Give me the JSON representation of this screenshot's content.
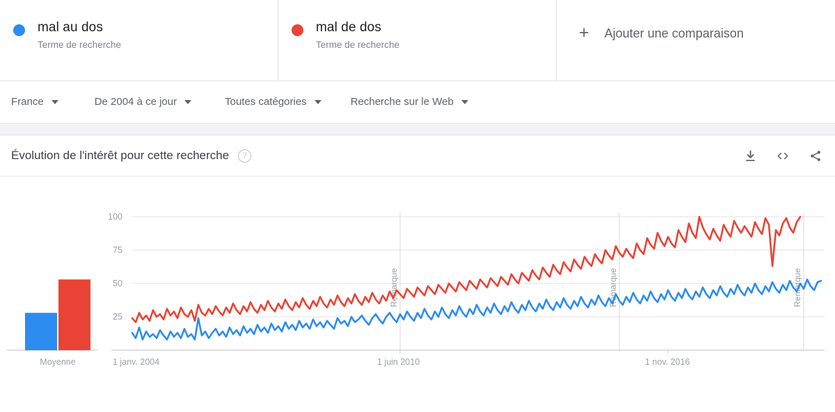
{
  "terms": [
    {
      "label": "mal au dos",
      "sublabel": "Terme de recherche",
      "color": "#2D8CF0",
      "dot": "blue-dot"
    },
    {
      "label": "mal de dos",
      "sublabel": "Terme de recherche",
      "color": "#EA4335",
      "dot": "red-dot"
    }
  ],
  "add_comparison": {
    "label": "Ajouter une comparaison",
    "icon": "plus-icon"
  },
  "filters": [
    {
      "label": "France",
      "name": "filter-region"
    },
    {
      "label": "De 2004 à ce jour",
      "name": "filter-timerange"
    },
    {
      "label": "Toutes catégories",
      "name": "filter-category"
    },
    {
      "label": "Recherche sur le Web",
      "name": "filter-searchtype"
    }
  ],
  "chart_header": {
    "title": "Évolution de l'intérêt pour cette recherche",
    "help": "?",
    "actions": [
      {
        "name": "download-icon",
        "title": "download"
      },
      {
        "name": "embed-code-icon",
        "title": "embed"
      },
      {
        "name": "share-icon",
        "title": "share"
      }
    ]
  },
  "average_panel": {
    "label": "Moyenne",
    "bars": [
      {
        "series": "mal au dos",
        "value": 28,
        "color": "#2D8CF0"
      },
      {
        "series": "mal de dos",
        "value": 53,
        "color": "#EA4335"
      }
    ]
  },
  "chart_data": {
    "type": "line",
    "title": "Évolution de l'intérêt pour cette recherche",
    "xlabel": "",
    "ylabel": "",
    "ylim": [
      0,
      100
    ],
    "yticks": [
      25,
      50,
      75,
      100
    ],
    "grid": true,
    "legend_position": "top",
    "x_tick_labels": [
      "1 janv. 2004",
      "1 juin 2010",
      "1 nov. 2016"
    ],
    "x_tick_index": [
      0,
      77,
      154
    ],
    "x_range": [
      "2004-01",
      "2020-08"
    ],
    "n_points": 200,
    "annotations": [
      {
        "label": "Remarque",
        "x_index": 77
      },
      {
        "label": "Remarque",
        "x_index": 140
      },
      {
        "label": "Remarque",
        "x_index": 193
      }
    ],
    "series": [
      {
        "name": "mal au dos",
        "color": "#2D8CF0",
        "values": [
          13,
          9,
          17,
          8,
          14,
          10,
          12,
          9,
          15,
          11,
          8,
          14,
          10,
          13,
          9,
          16,
          10,
          12,
          8,
          24,
          11,
          14,
          9,
          13,
          16,
          11,
          14,
          10,
          17,
          12,
          15,
          11,
          18,
          13,
          16,
          12,
          19,
          14,
          17,
          13,
          20,
          15,
          18,
          14,
          21,
          16,
          19,
          15,
          22,
          17,
          20,
          16,
          23,
          18,
          21,
          17,
          22,
          19,
          16,
          24,
          20,
          22,
          18,
          25,
          21,
          23,
          26,
          22,
          19,
          24,
          27,
          23,
          20,
          25,
          28,
          24,
          21,
          27,
          23,
          29,
          25,
          22,
          28,
          24,
          31,
          26,
          23,
          29,
          25,
          32,
          27,
          24,
          30,
          26,
          33,
          28,
          25,
          31,
          27,
          34,
          29,
          26,
          32,
          28,
          35,
          30,
          27,
          33,
          29,
          36,
          31,
          28,
          34,
          30,
          37,
          32,
          29,
          35,
          31,
          38,
          33,
          30,
          36,
          32,
          39,
          34,
          31,
          37,
          33,
          40,
          35,
          32,
          38,
          34,
          41,
          36,
          33,
          39,
          35,
          42,
          37,
          34,
          40,
          36,
          43,
          38,
          35,
          41,
          37,
          44,
          39,
          36,
          42,
          38,
          45,
          40,
          37,
          43,
          39,
          46,
          41,
          38,
          44,
          40,
          47,
          42,
          39,
          45,
          41,
          48,
          43,
          40,
          46,
          42,
          49,
          44,
          41,
          47,
          43,
          50,
          45,
          42,
          48,
          44,
          51,
          46,
          43,
          49,
          45,
          52,
          47,
          44,
          50,
          46,
          53,
          48,
          45,
          51,
          52
        ]
      },
      {
        "name": "mal de dos",
        "color": "#EA4335",
        "values": [
          24,
          21,
          28,
          23,
          26,
          22,
          30,
          25,
          27,
          23,
          31,
          26,
          29,
          24,
          32,
          27,
          25,
          30,
          22,
          34,
          28,
          26,
          31,
          27,
          33,
          29,
          26,
          32,
          28,
          35,
          30,
          27,
          33,
          29,
          36,
          31,
          28,
          34,
          30,
          37,
          32,
          29,
          35,
          31,
          38,
          33,
          30,
          36,
          32,
          39,
          34,
          31,
          37,
          33,
          40,
          35,
          32,
          38,
          34,
          41,
          36,
          33,
          39,
          35,
          42,
          37,
          34,
          40,
          36,
          43,
          38,
          35,
          41,
          37,
          44,
          39,
          45,
          42,
          39,
          46,
          43,
          40,
          47,
          44,
          41,
          48,
          45,
          42,
          49,
          46,
          43,
          50,
          47,
          44,
          51,
          48,
          45,
          52,
          49,
          46,
          53,
          50,
          47,
          54,
          51,
          48,
          55,
          52,
          49,
          57,
          53,
          50,
          58,
          55,
          52,
          60,
          56,
          53,
          62,
          58,
          55,
          64,
          60,
          57,
          66,
          62,
          59,
          68,
          64,
          61,
          70,
          66,
          63,
          72,
          68,
          65,
          75,
          71,
          68,
          78,
          73,
          70,
          76,
          72,
          69,
          80,
          75,
          72,
          84,
          79,
          76,
          88,
          82,
          78,
          85,
          80,
          77,
          90,
          85,
          81,
          95,
          88,
          84,
          100,
          92,
          87,
          83,
          91,
          86,
          82,
          94,
          89,
          85,
          97,
          92,
          88,
          93,
          89,
          85,
          96,
          91,
          87,
          99,
          94,
          63,
          90,
          86,
          95,
          99,
          92,
          88,
          96,
          100
        ]
      }
    ]
  }
}
